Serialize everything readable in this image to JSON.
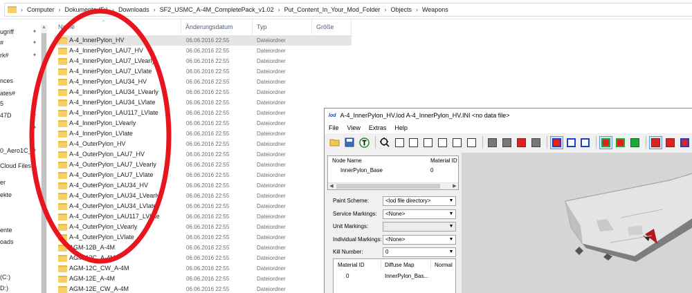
{
  "address": {
    "crumbs": [
      "Computer",
      "Dokumente (F:)",
      "Downloads",
      "SF2_USMC_A-4M_CompletePack_v1.02",
      "Put_Content_In_Your_Mod_Folder",
      "Objects",
      "Weapons"
    ]
  },
  "nav": {
    "items": [
      "ugriff",
      "#",
      "rk#",
      "",
      "nces",
      "ates#",
      "5",
      "47D",
      "",
      "0_Aero1C_e",
      "Cloud Files",
      "er",
      "ekte",
      "",
      "",
      "ente",
      "oads",
      "",
      "",
      "(C:)",
      "D:)"
    ]
  },
  "columns": {
    "name": "Name",
    "date": "Änderungsdatum",
    "type": "Typ",
    "size": "Größe"
  },
  "files": [
    {
      "name": "A-4_InnerPylon_HV",
      "date": "06.06.2016 22:55",
      "type": "Dateiordner"
    },
    {
      "name": "A-4_InnerPylon_LAU7_HV",
      "date": "06.06.2016 22:55",
      "type": "Dateiordner"
    },
    {
      "name": "A-4_InnerPylon_LAU7_LVearly",
      "date": "06.06.2016 22:55",
      "type": "Dateiordner"
    },
    {
      "name": "A-4_InnerPylon_LAU7_LVlate",
      "date": "06.06.2016 22:55",
      "type": "Dateiordner"
    },
    {
      "name": "A-4_InnerPylon_LAU34_HV",
      "date": "06.06.2016 22:55",
      "type": "Dateiordner"
    },
    {
      "name": "A-4_InnerPylon_LAU34_LVearly",
      "date": "06.06.2016 22:55",
      "type": "Dateiordner"
    },
    {
      "name": "A-4_InnerPylon_LAU34_LVlate",
      "date": "06.06.2016 22:55",
      "type": "Dateiordner"
    },
    {
      "name": "A-4_InnerPylon_LAU117_LVlate",
      "date": "06.06.2016 22:55",
      "type": "Dateiordner"
    },
    {
      "name": "A-4_InnerPylon_LVearly",
      "date": "06.06.2016 22:55",
      "type": "Dateiordner"
    },
    {
      "name": "A-4_InnerPylon_LVlate",
      "date": "06.06.2016 22:55",
      "type": "Dateiordner"
    },
    {
      "name": "A-4_OuterPylon_HV",
      "date": "06.06.2016 22:55",
      "type": "Dateiordner"
    },
    {
      "name": "A-4_OuterPylon_LAU7_HV",
      "date": "06.06.2016 22:55",
      "type": "Dateiordner"
    },
    {
      "name": "A-4_OuterPylon_LAU7_LVearly",
      "date": "06.06.2016 22:55",
      "type": "Dateiordner"
    },
    {
      "name": "A-4_OuterPylon_LAU7_LVlate",
      "date": "06.06.2016 22:55",
      "type": "Dateiordner"
    },
    {
      "name": "A-4_OuterPylon_LAU34_HV",
      "date": "06.06.2016 22:55",
      "type": "Dateiordner"
    },
    {
      "name": "A-4_OuterPylon_LAU34_LVearly",
      "date": "06.06.2016 22:55",
      "type": "Dateiordner"
    },
    {
      "name": "A-4_OuterPylon_LAU34_LVlate",
      "date": "06.06.2016 22:55",
      "type": "Dateiordner"
    },
    {
      "name": "A-4_OuterPylon_LAU117_LVlate",
      "date": "06.06.2016 22:55",
      "type": "Dateiordner"
    },
    {
      "name": "A-4_OuterPylon_LVearly",
      "date": "06.06.2016 22:55",
      "type": "Dateiordner"
    },
    {
      "name": "A-4_OuterPylon_LVlate",
      "date": "06.06.2016 22:55",
      "type": "Dateiordner"
    },
    {
      "name": "AGM-12B_A-4M",
      "date": "06.06.2016 22:55",
      "type": "Dateiordner"
    },
    {
      "name": "AGM-12C_A-4M",
      "date": "06.06.2016 22:55",
      "type": "Dateiordner"
    },
    {
      "name": "AGM-12C_CW_A-4M",
      "date": "06.06.2016 22:55",
      "type": "Dateiordner"
    },
    {
      "name": "AGM-12E_A-4M",
      "date": "06.06.2016 22:55",
      "type": "Dateiordner"
    },
    {
      "name": "AGM-12E_CW_A-4M",
      "date": "06.06.2016 22:55",
      "type": "Dateiordner"
    }
  ],
  "lodviewer": {
    "logo": "lod",
    "title": "A-4_InnerPylon_HV.lod  A-4_InnerPylon_HV.INI  <no data file>",
    "menu": [
      "File",
      "View",
      "Extras",
      "Help"
    ],
    "node_header": "Node Name",
    "material_header": "Material ID",
    "node_name": "InnerPylon_Base",
    "node_material": "0",
    "paint_label": "Paint Scheme:",
    "paint_value": "<lod file directory>",
    "service_label": "Service Markings:",
    "service_value": "<None>",
    "unit_label": "Unit Markings:",
    "unit_value": "",
    "individual_label": "Individual Markings:",
    "individual_value": "<None>",
    "kill_label": "Kill Number:",
    "kill_value": "0",
    "mat_headers": [
      "Material ID",
      "Diffuse Map",
      "Normal"
    ],
    "mat_row": [
      "0",
      "InnerPylon_Bas..."
    ]
  },
  "colors": {
    "folder": "#f6d067",
    "annotation": "#e8141e",
    "selection": "#e5e5e5"
  },
  "icons": [
    "folder-icon",
    "pin-icon",
    "open-icon",
    "save-icon",
    "text-icon",
    "zoom-icon",
    "wireframe-cube-icon",
    "solid-cube-icon",
    "red-cube-icon",
    "blue-cube-icon",
    "green-cube-icon"
  ]
}
